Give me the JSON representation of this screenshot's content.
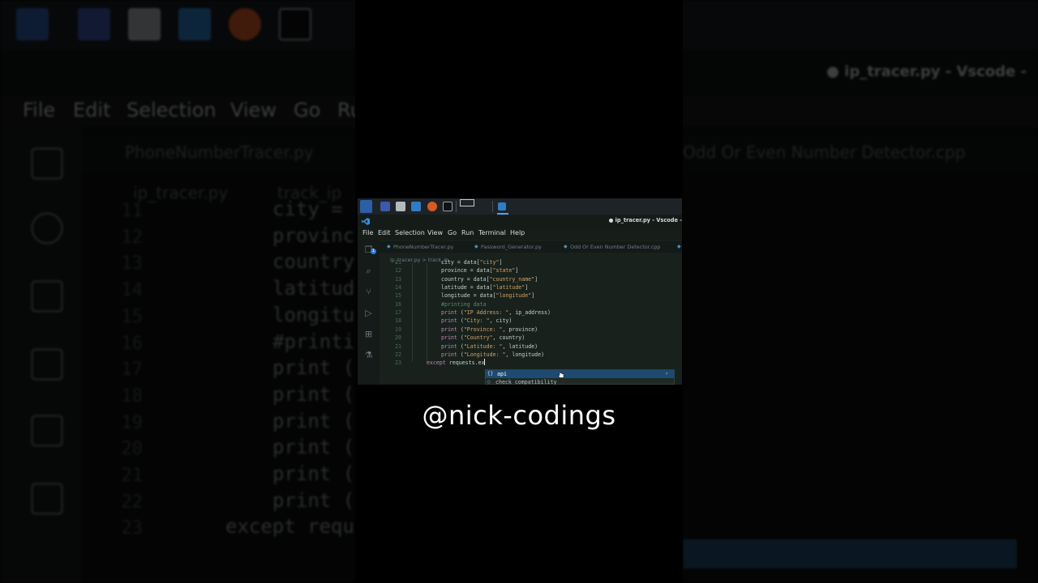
{
  "window": {
    "title": "● ip_tracer.py - Vscode -"
  },
  "menu": [
    "File",
    "Edit",
    "Selection",
    "View",
    "Go",
    "Run",
    "Terminal",
    "Help"
  ],
  "tabs": [
    {
      "label": "PhoneNumberTracer.py"
    },
    {
      "label": "Password_Generator.py"
    },
    {
      "label": "Odd Or Even Number Detector.cpp"
    }
  ],
  "breadcrumb": {
    "file": "ip_tracer.py",
    "separator": ">",
    "symbol": "track_ip"
  },
  "editor": {
    "lines": [
      {
        "num": "11",
        "text": "city = data[\"city\"]"
      },
      {
        "num": "12",
        "text": "province = data[\"state\"]"
      },
      {
        "num": "13",
        "text": "country = data[\"country_name\"]"
      },
      {
        "num": "14",
        "text": "latitude = data[\"latitude\"]"
      },
      {
        "num": "15",
        "text": "longitude = data[\"longitude\"]"
      },
      {
        "num": "16",
        "text": "#printing data"
      },
      {
        "num": "17",
        "text": "print (\"IP Address: \", ip_address)"
      },
      {
        "num": "18",
        "text": "print (\"City: \", city)"
      },
      {
        "num": "19",
        "text": "print (\"Province: \", province)"
      },
      {
        "num": "20",
        "text": "print (\"Country\", country)"
      },
      {
        "num": "21",
        "text": "print (\"Latitude: \", latitude)"
      },
      {
        "num": "22",
        "text": "print (\"Longitude: \", longitude)"
      },
      {
        "num": "23",
        "text": "except requests.ex"
      }
    ]
  },
  "suggestions": [
    {
      "icon": "{}",
      "label": "api"
    },
    {
      "icon": "○",
      "label": "check_compatibility"
    }
  ],
  "background_zoom": {
    "tabs": [
      "PhoneNumberTracer.py",
      "Odd Or Even Number Detector.cpp"
    ],
    "breadcrumb_file": "ip_tracer.py",
    "breadcrumb_symbol": "track_ip",
    "title": "● ip_tracer.py - Vscode -",
    "menu": [
      "File",
      "Edit",
      "Selection",
      "View",
      "Go",
      "Ru"
    ],
    "lines": [
      {
        "num": "11",
        "text": "city ="
      },
      {
        "num": "12",
        "text": "provinc"
      },
      {
        "num": "13",
        "text": "country"
      },
      {
        "num": "14",
        "text": "latitud"
      },
      {
        "num": "15",
        "text": "longitu"
      },
      {
        "num": "16",
        "text": "#printi"
      },
      {
        "num": "17",
        "text": "print ("
      },
      {
        "num": "18",
        "text": "print ("
      },
      {
        "num": "19",
        "text": "print ("
      },
      {
        "num": "20",
        "text": "print ("
      },
      {
        "num": "21",
        "text": "print ("
      },
      {
        "num": "22",
        "text": "print ("
      },
      {
        "num": "23",
        "text": "except requ"
      }
    ]
  },
  "watermark": "@nick-codings",
  "colors": {
    "editor_bg": "#18211c",
    "accent": "#4ea4f0",
    "suggest_selected": "#1d4a70"
  }
}
